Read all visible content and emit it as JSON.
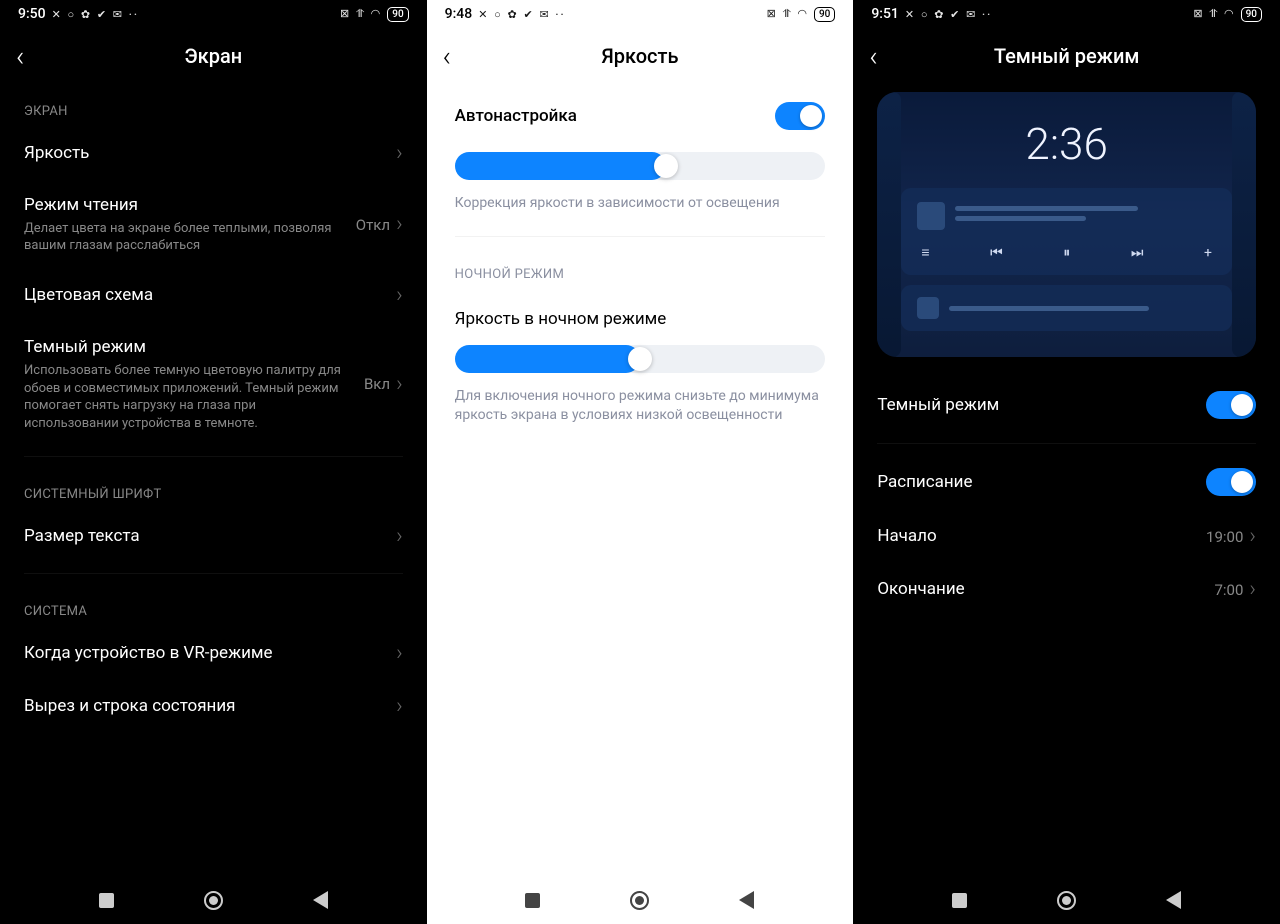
{
  "panel1": {
    "time": "9:50",
    "battery": "90",
    "title": "Экран",
    "section_screen": "ЭКРАН",
    "brightness": "Яркость",
    "reading_mode_title": "Режим чтения",
    "reading_mode_desc": "Делает цвета на экране более теплыми, позволяя вашим глазам расслабиться",
    "reading_mode_value": "Откл",
    "color_scheme": "Цветовая схема",
    "dark_mode_title": "Темный режим",
    "dark_mode_desc": "Использовать более темную цветовую палитру для обоев и совместимых приложений. Темный режим помогает снять нагрузку на глаза при использовании устройства в темноте.",
    "dark_mode_value": "Вкл",
    "section_font": "СИСТЕМНЫЙ ШРИФТ",
    "text_size": "Размер текста",
    "section_system": "СИСТЕМА",
    "vr_mode": "Когда устройство в VR-режиме",
    "notch": "Вырез и строка состояния"
  },
  "panel2": {
    "time": "9:48",
    "battery": "90",
    "title": "Яркость",
    "auto_adjust": "Автонастройка",
    "desc1": "Коррекция яркости в зависимости от освещения",
    "section_night": "НОЧНОЙ РЕЖИМ",
    "night_brightness": "Яркость в ночном режиме",
    "desc2": "Для включения ночного режима снизьте до минимума яркость экрана в условиях низкой освещенности",
    "slider1_pct": 57,
    "slider2_pct": 50
  },
  "panel3": {
    "time": "9:51",
    "battery": "90",
    "title": "Темный режим",
    "preview_time": "2:36",
    "dark_mode": "Темный режим",
    "schedule": "Расписание",
    "start": "Начало",
    "start_value": "19:00",
    "end": "Окончание",
    "end_value": "7:00"
  }
}
